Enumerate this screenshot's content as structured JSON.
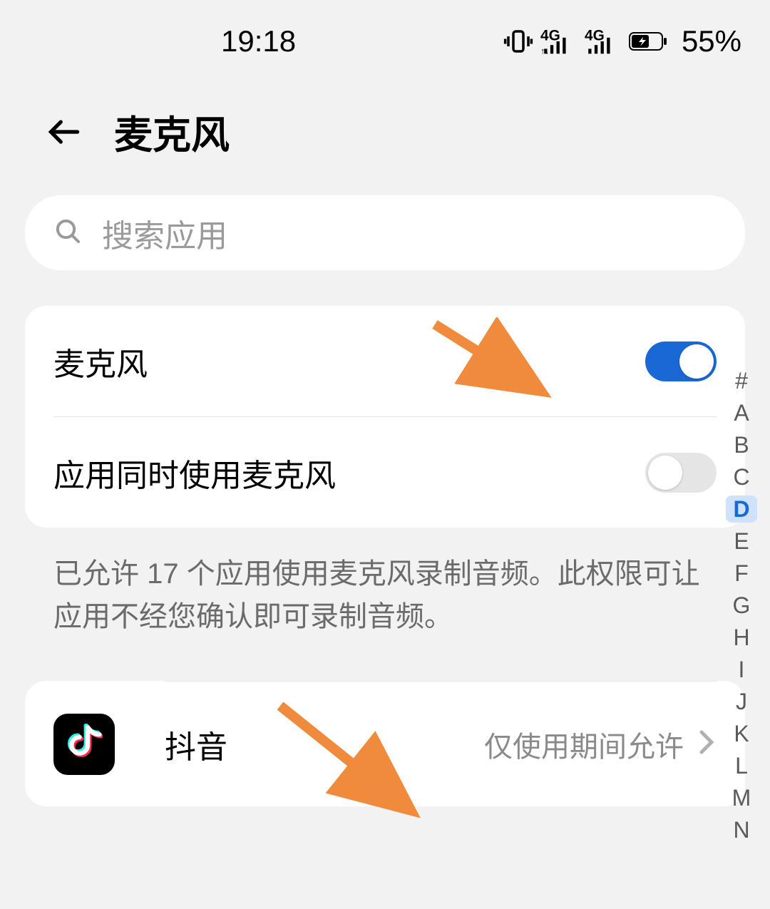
{
  "statusbar": {
    "time": "19:18",
    "battery": "55%"
  },
  "header": {
    "title": "麦克风"
  },
  "search": {
    "placeholder": "搜索应用"
  },
  "toggles": {
    "microphone": {
      "label": "麦克风",
      "on": true
    },
    "multi_app": {
      "label": "应用同时使用麦克风",
      "on": false
    }
  },
  "description": "已允许 17 个应用使用麦克风录制音频。此权限可让应用不经您确认即可录制音频。",
  "apps": [
    {
      "name": "抖音",
      "status": "仅使用期间允许",
      "icon": "douyin"
    }
  ],
  "index": {
    "items": [
      "#",
      "A",
      "B",
      "C",
      "D",
      "E",
      "F",
      "G",
      "H",
      "I",
      "J",
      "K",
      "L",
      "M",
      "N"
    ],
    "active": "D"
  }
}
